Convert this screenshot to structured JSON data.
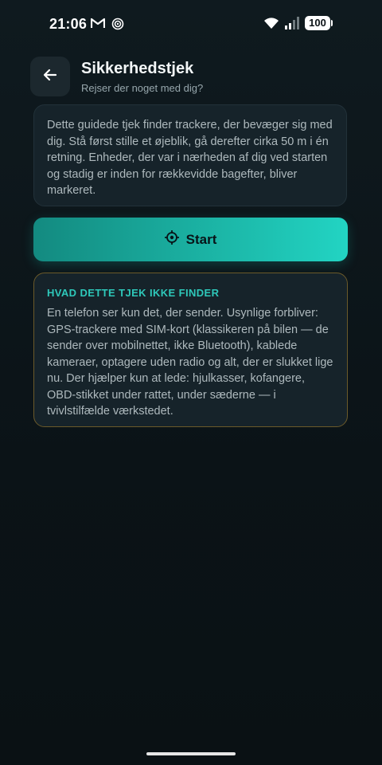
{
  "status_bar": {
    "time": "21:06",
    "battery": "100",
    "icons": [
      "gmail-icon",
      "target-icon",
      "wifi-icon",
      "signal-icon",
      "battery-icon"
    ]
  },
  "header": {
    "title": "Sikkerhedstjek",
    "subtitle": "Rejser der noget med dig?",
    "back_icon": "arrow-left-icon"
  },
  "info_card": {
    "text": "Dette guidede tjek finder trackere, der bevæger sig med dig. Stå først stille et øjeblik, gå derefter cirka 50 m i én retning. Enheder, der var i nærheden af dig ved starten og stadig er inden for rækkevidde bagefter, bliver markeret."
  },
  "start_button": {
    "label": "Start",
    "icon": "crosshair-icon"
  },
  "warning_card": {
    "title": "HVAD DETTE TJEK IKKE FINDER",
    "text": "En telefon ser kun det, der sender. Usynlige forbliver: GPS-trackere med SIM-kort (klassikeren på bilen — de sender over mobilnettet, ikke Bluetooth), kablede kameraer, optagere uden radio og alt, der er slukket lige nu. Der hjælper kun at lede: hjulkasser, kofangere, OBD-stikket under rattet, under sæderne — i tvivlstilfælde værkstedet."
  },
  "colors": {
    "background": "#0b1216",
    "card": "#16232a",
    "accent": "#22d4c3",
    "warning_border": "#6b5a2a"
  }
}
